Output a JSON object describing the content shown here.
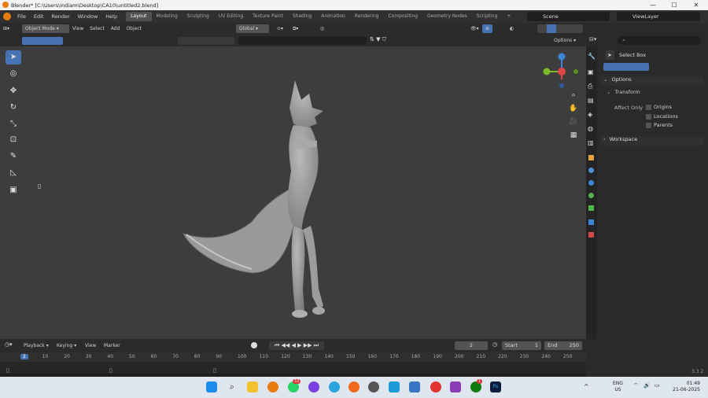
{
  "window": {
    "title": "Blender* [C:\\Users\\indiam\\Desktop\\CA10\\untitled2.blend]",
    "controls": [
      "—",
      "☐",
      "✕"
    ]
  },
  "menubar": {
    "menus": [
      "File",
      "Edit",
      "Render",
      "Window",
      "Help"
    ],
    "workspaces": [
      "Layout",
      "Modeling",
      "Sculpting",
      "UV Editing",
      "Texture Paint",
      "Shading",
      "Animation",
      "Rendering",
      "Compositing",
      "Geometry Nodes",
      "Scripting"
    ],
    "active_workspace": "Layout",
    "add_tab": "+",
    "scene": "Scene",
    "view_layer": "ViewLayer"
  },
  "viewport_header": {
    "mode": "Object Mode",
    "menus": [
      "View",
      "Select",
      "Add",
      "Object"
    ],
    "orientation": "Global",
    "options": "Options"
  },
  "right_panel": {
    "search_placeholder": "",
    "tool_name": "Select Box",
    "options_label": "Options",
    "transform_label": "Transform",
    "affect_only": "Affect Only",
    "checkboxes": [
      "Origins",
      "Locations",
      "Parents"
    ],
    "workspace_label": "Workspace"
  },
  "timeline": {
    "menus": [
      "Playback",
      "Keying",
      "View",
      "Marker"
    ],
    "current_frame": "2",
    "start_label": "Start",
    "start_value": "1",
    "end_label": "End",
    "end_value": "250",
    "ruler": [
      "2",
      "10",
      "20",
      "30",
      "40",
      "50",
      "60",
      "70",
      "80",
      "90",
      "100",
      "110",
      "120",
      "130",
      "140",
      "150",
      "160",
      "170",
      "180",
      "190",
      "200",
      "210",
      "220",
      "230",
      "240",
      "250"
    ]
  },
  "status": {
    "version": "3.3.2"
  },
  "taskbar": {
    "lang_line1": "ENG",
    "lang_line2": "US",
    "time": "01:49",
    "date": "21-06-2025",
    "badge_whatsapp": "10",
    "badge_xbox": "1",
    "tray_arrow": "^",
    "ps_label": "Ps"
  },
  "colors": {
    "accent": "#4772b3",
    "viewport_bg": "#3d3d3d",
    "axis_x": "#e04545",
    "axis_y": "#7cba2a",
    "axis_z": "#3a86d8",
    "blender_orange": "#e87d0d"
  }
}
